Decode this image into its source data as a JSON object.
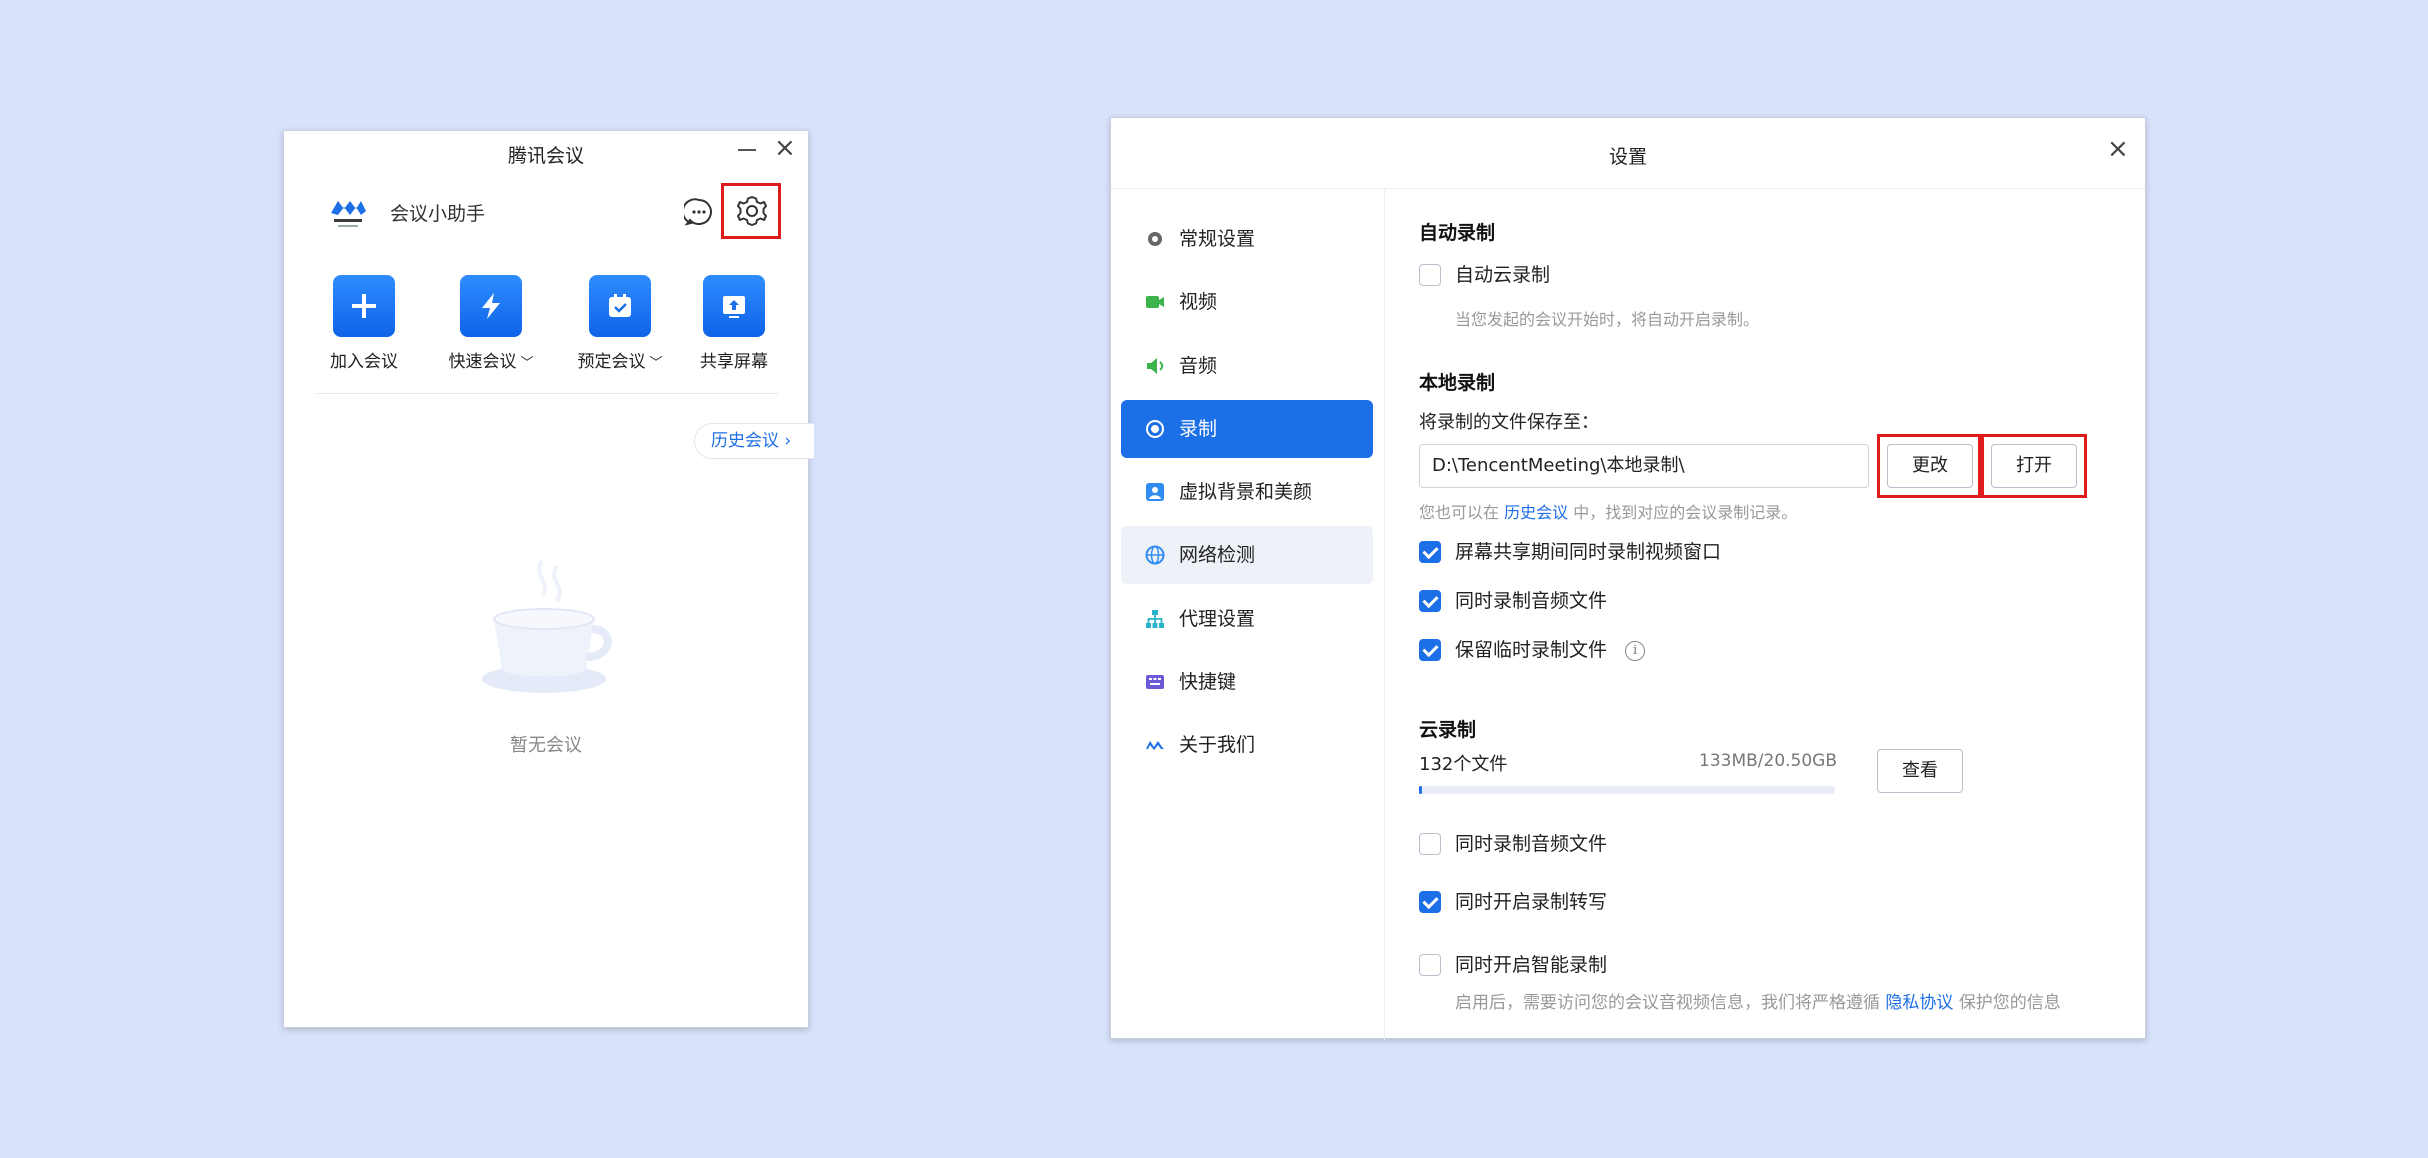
{
  "left_window": {
    "title": "腾讯会议",
    "assistant_label": "会议小助手",
    "actions": [
      {
        "label": "加入会议",
        "icon": "plus-icon",
        "has_dropdown": false
      },
      {
        "label": "快速会议",
        "icon": "lightning-icon",
        "has_dropdown": true
      },
      {
        "label": "预定会议",
        "icon": "calendar-check-icon",
        "has_dropdown": true
      },
      {
        "label": "共享屏幕",
        "icon": "share-screen-icon",
        "has_dropdown": false
      }
    ],
    "history_label": "历史会议",
    "empty_text": "暂无会议"
  },
  "right_window": {
    "title": "设置",
    "nav": [
      {
        "label": "常规设置",
        "icon": "gear-icon",
        "color": "#666666"
      },
      {
        "label": "视频",
        "icon": "video-icon",
        "color": "#3cb44b"
      },
      {
        "label": "音频",
        "icon": "speaker-icon",
        "color": "#3cb44b"
      },
      {
        "label": "录制",
        "icon": "record-icon",
        "color": "#ffffff",
        "state": "active"
      },
      {
        "label": "虚拟背景和美颜",
        "icon": "portrait-icon",
        "color": "#2f8cf0"
      },
      {
        "label": "网络检测",
        "icon": "globe-icon",
        "color": "#2f8cf0",
        "state": "hover"
      },
      {
        "label": "代理设置",
        "icon": "network-tree-icon",
        "color": "#28b3c8"
      },
      {
        "label": "快捷键",
        "icon": "keyboard-icon",
        "color": "#6a5ad8"
      },
      {
        "label": "关于我们",
        "icon": "tencent-meeting-logo-icon",
        "color": "#1c6fe6"
      }
    ],
    "auto_record": {
      "title": "自动录制",
      "cloud_option": "自动云录制",
      "cloud_checked": false,
      "hint": "当您发起的会议开始时，将自动开启录制。"
    },
    "local_record": {
      "title": "本地录制",
      "save_label": "将录制的文件保存至：",
      "path": "D:\\TencentMeeting\\本地录制\\",
      "change_button": "更改",
      "open_button": "打开",
      "hint_prefix": "您也可以在",
      "hint_link": "历史会议",
      "hint_suffix": "中，找到对应的会议录制记录。",
      "options": [
        {
          "label": "屏幕共享期间同时录制视频窗口",
          "checked": true
        },
        {
          "label": "同时录制音频文件",
          "checked": true
        },
        {
          "label": "保留临时录制文件",
          "checked": true,
          "info": true
        }
      ]
    },
    "cloud_record": {
      "title": "云录制",
      "file_count": "132个文件",
      "usage": "133MB/20.50GB",
      "usage_fraction": 0.0065,
      "view_button": "查看",
      "options": [
        {
          "label": "同时录制音频文件",
          "checked": false
        },
        {
          "label": "同时开启录制转写",
          "checked": true
        },
        {
          "label": "同时开启智能录制",
          "checked": false
        }
      ],
      "smart_hint_prefix": "启用后，需要访问您的会议音视频信息，我们将严格遵循",
      "smart_hint_link": "隐私协议",
      "smart_hint_suffix": "保护您的信息"
    }
  }
}
